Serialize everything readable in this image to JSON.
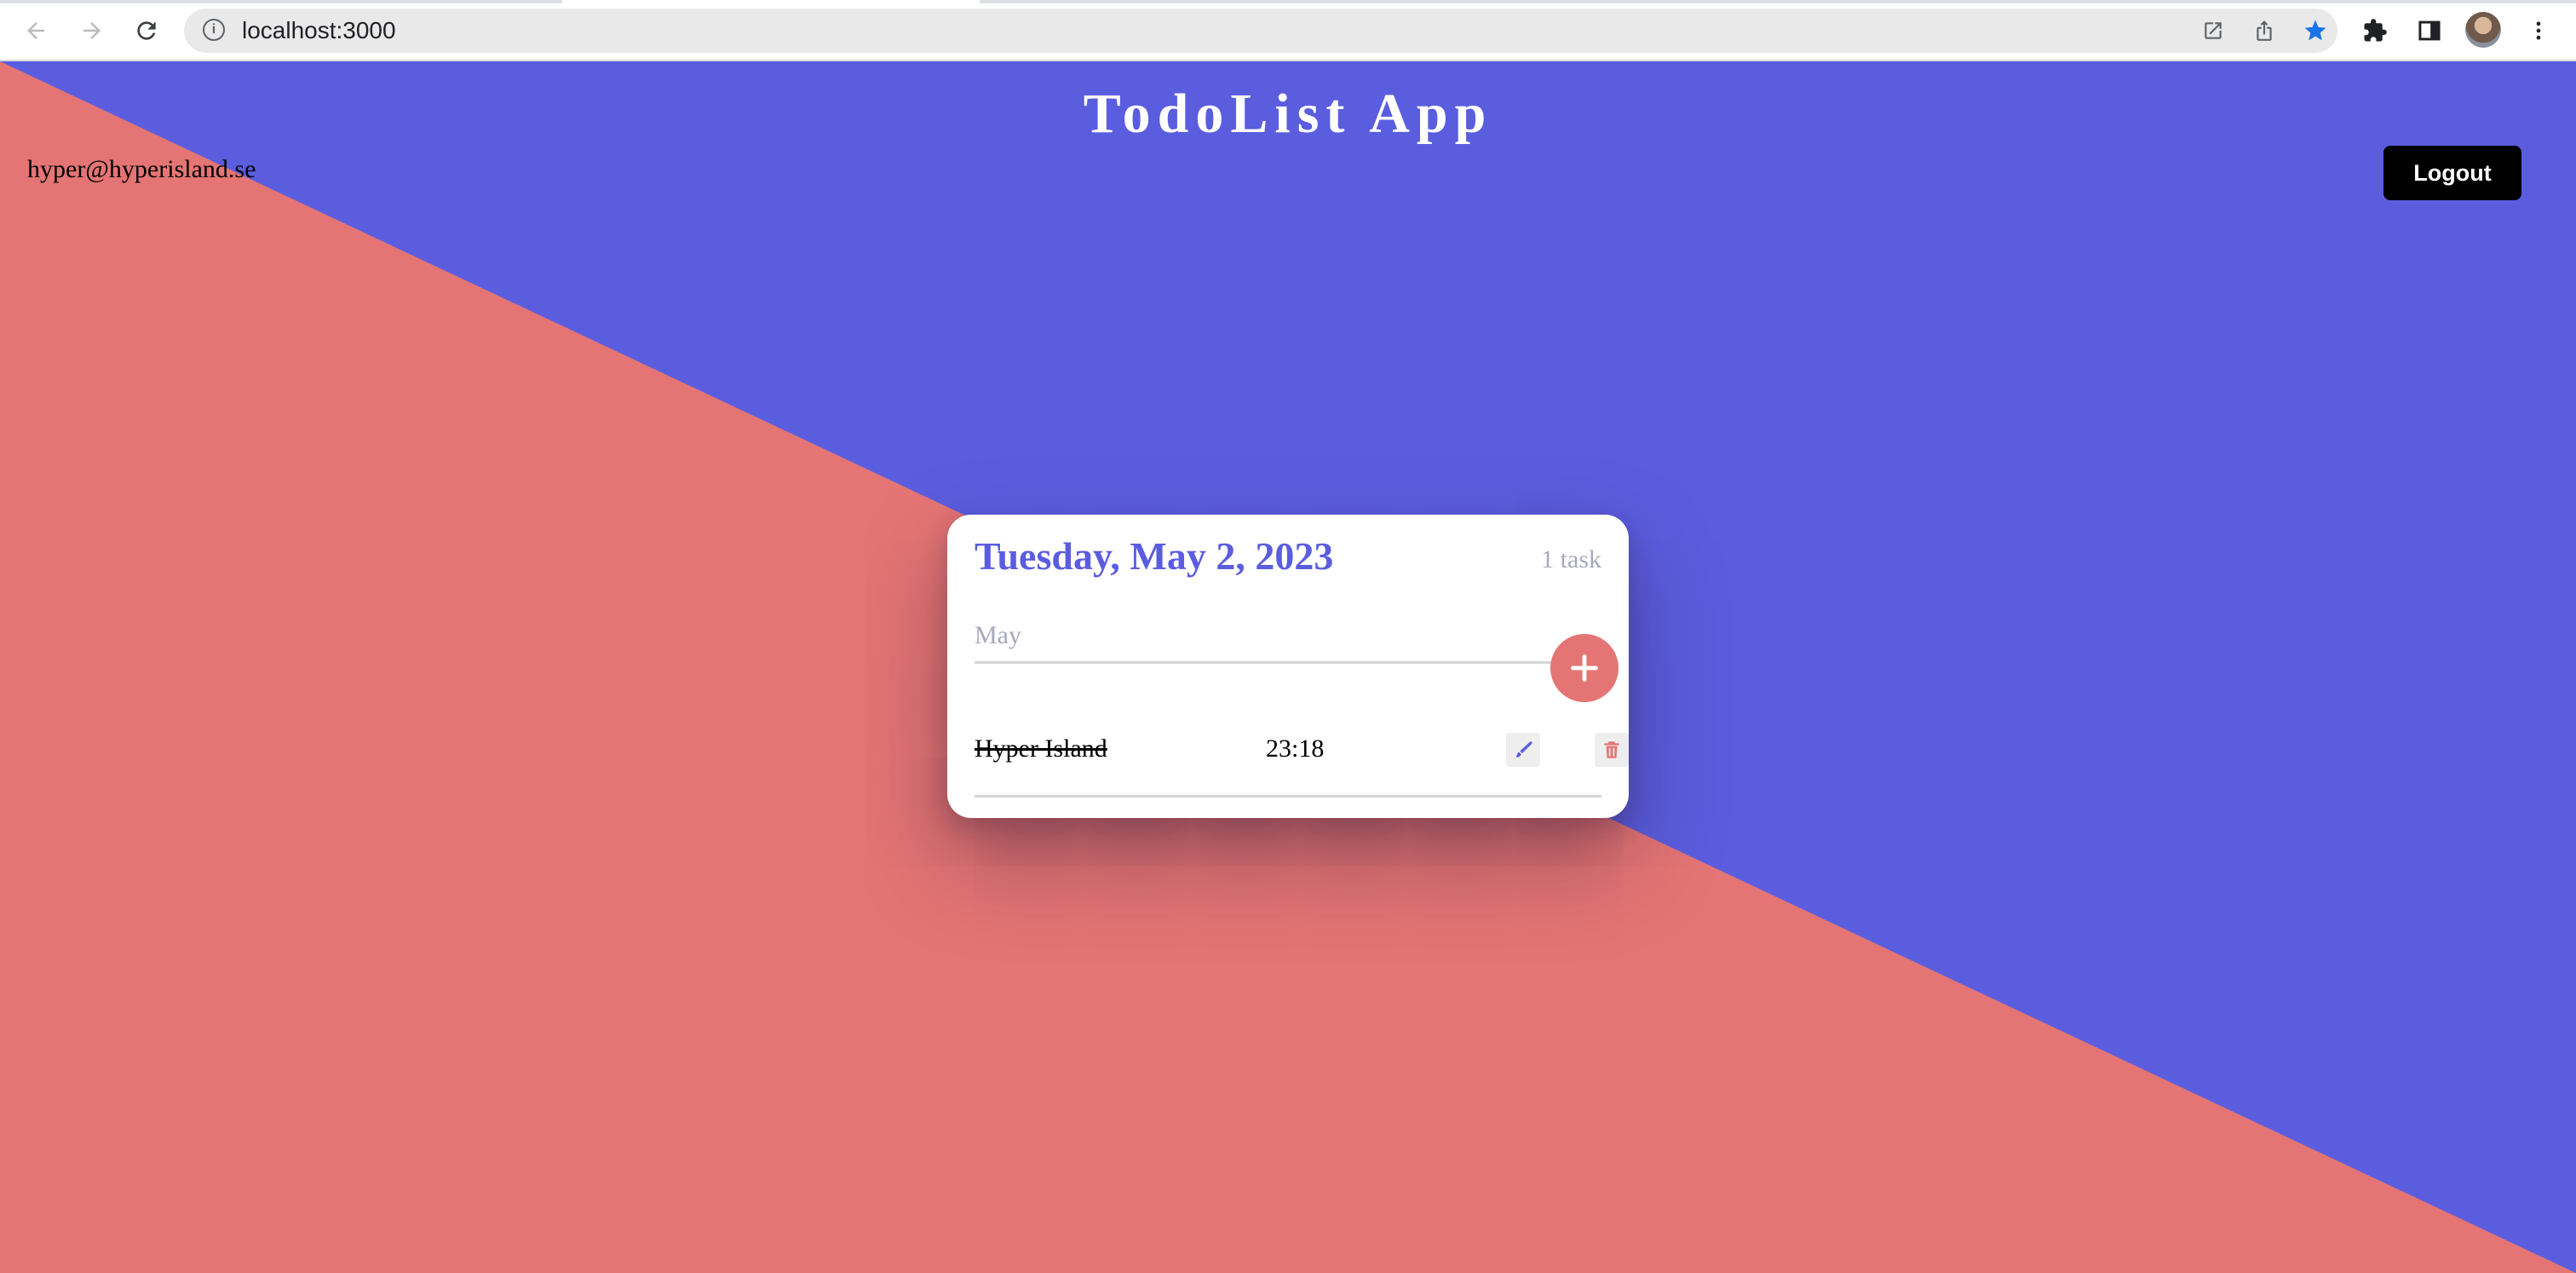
{
  "browser": {
    "url": "localhost:3000",
    "nav": {
      "back_icon": "arrow-left-icon",
      "forward_icon": "arrow-right-icon",
      "reload_icon": "reload-icon"
    },
    "toolbar_icons": [
      "open-in-new-icon",
      "share-icon",
      "bookmark-star-icon",
      "extensions-puzzle-icon",
      "side-panel-icon",
      "profile-avatar",
      "more-vert-icon"
    ],
    "bookmark_color": "#1a73e8"
  },
  "app": {
    "title": "TodoList App",
    "user_email": "hyper@hyperisland.se",
    "logout_label": "Logout",
    "colors": {
      "blue": "#5b5ddf",
      "red": "#e57574",
      "button": "#000000"
    }
  },
  "card": {
    "date": "Tuesday, May 2, 2023",
    "task_count": "1 task",
    "input": {
      "value": "",
      "placeholder": "May"
    },
    "add_icon": "plus-icon",
    "tasks": [
      {
        "name": "Hyper Island",
        "time": "23:18",
        "completed": true,
        "edit_icon": "pencil-icon",
        "delete_icon": "trash-icon"
      }
    ]
  }
}
